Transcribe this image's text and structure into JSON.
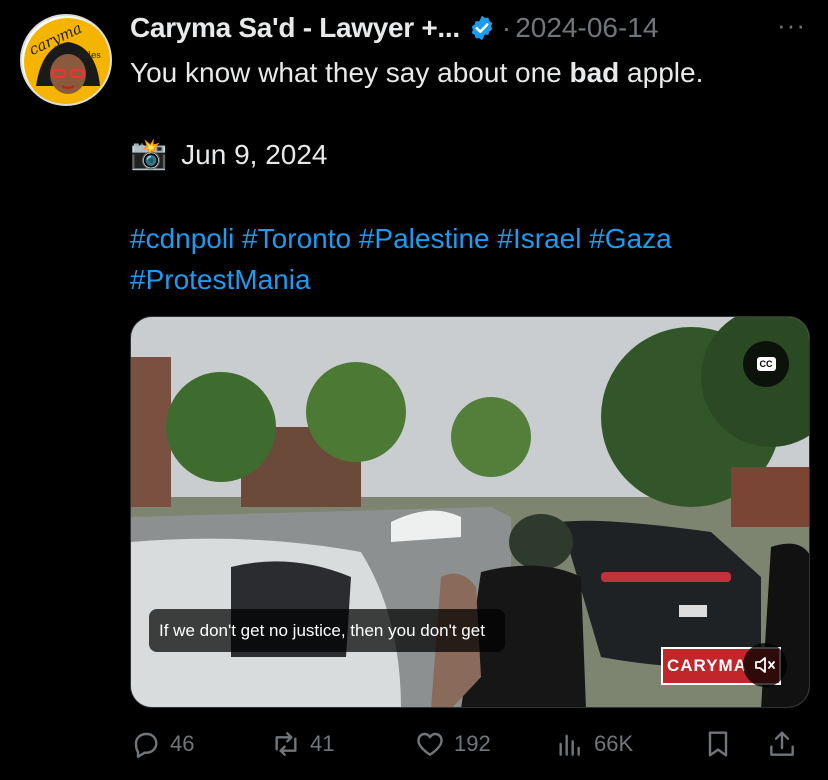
{
  "author": {
    "name": "Caryma Sa'd - Lawyer +...",
    "avatar_text": "caryma rules",
    "verified_icon": "verified-badge-icon"
  },
  "tweet": {
    "date": "2024-06-14",
    "separator": "·",
    "more": "···",
    "line1_pre": "You know what they say about one ",
    "line1_bold": "bad",
    "line1_post": " apple.",
    "camera_icon": "📸",
    "photo_date": "Jun 9, 2024",
    "hashtags": [
      "#cdnpoli",
      "#Toronto",
      "#Palestine",
      "#Israel",
      "#Gaza",
      "#ProtestMania"
    ]
  },
  "video": {
    "caption": "If we don't get no justice, then you don't get",
    "cc_label": "CC",
    "watermark": "CARYMA"
  },
  "actions": {
    "replies": "46",
    "reposts": "41",
    "likes": "192",
    "views": "66K"
  },
  "colors": {
    "accent": "#1d9bf0",
    "muted": "#71767b",
    "background": "#000000"
  }
}
